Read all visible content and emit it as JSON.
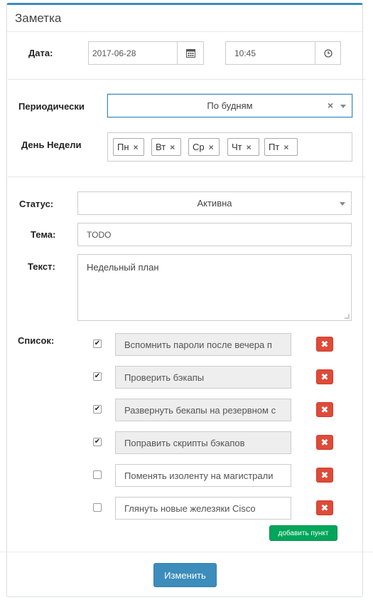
{
  "title": "Заметка",
  "date": {
    "label": "Дата:",
    "value": "2017-06-28",
    "calendar_icon": "calendar-icon"
  },
  "time": {
    "value": "10:45",
    "clock_icon": "clock-icon"
  },
  "periodic": {
    "label": "Периодически",
    "value": "По будням",
    "clear": "×"
  },
  "weekday": {
    "label": "День Недели",
    "tags": [
      "Пн",
      "Вт",
      "Ср",
      "Чт",
      "Пт"
    ],
    "remove": "×"
  },
  "status": {
    "label": "Статус:",
    "value": "Активна"
  },
  "topic": {
    "label": "Тема:",
    "value": "TODO"
  },
  "text": {
    "label": "Текст:",
    "value": "Недельный план"
  },
  "list": {
    "label": "Список:",
    "items": [
      {
        "text": "Вспомнить пароли после вечера п",
        "checked": true
      },
      {
        "text": "Проверить бэкапы",
        "checked": true
      },
      {
        "text": "Развернуть бекапы на резервном с",
        "checked": true
      },
      {
        "text": "Поправить скрипты бэкапов",
        "checked": true
      },
      {
        "text": "Поменять изоленту на магистрали",
        "checked": false
      },
      {
        "text": "Глянуть новые железяки Cisco",
        "checked": false
      }
    ],
    "check_mark": "✔",
    "delete_label": "✖",
    "add_label": "добавить пункт"
  },
  "submit_label": "Изменить",
  "colors": {
    "primary": "#3c8dbc",
    "danger": "#dd4b39",
    "success": "#00a65a"
  }
}
